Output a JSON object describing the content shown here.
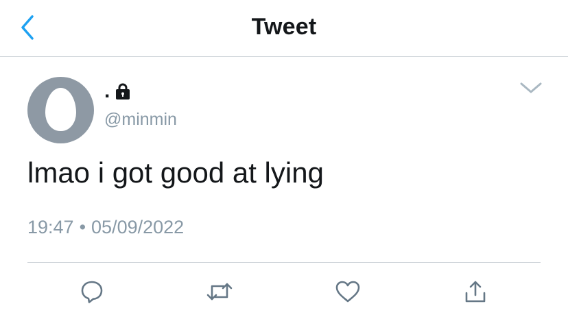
{
  "header": {
    "title": "Tweet",
    "back_icon": "chevron-left-icon",
    "accent_color": "#1da1f2"
  },
  "tweet": {
    "display_name": ".",
    "protected_icon": "lock-icon",
    "handle": "@minmin",
    "avatar": "default-egg-avatar",
    "more_icon": "chevron-down-icon",
    "text": "lmao i got good at lying",
    "time": "19:47",
    "separator": "•",
    "date": "05/09/2022"
  },
  "actions": [
    {
      "icon": "reply-icon"
    },
    {
      "icon": "retweet-icon"
    },
    {
      "icon": "like-icon"
    },
    {
      "icon": "share-icon"
    }
  ],
  "colors": {
    "text": "#14171a",
    "secondary": "#8899a6",
    "border": "#cfd4d9",
    "avatar_bg": "#8e99a4"
  }
}
